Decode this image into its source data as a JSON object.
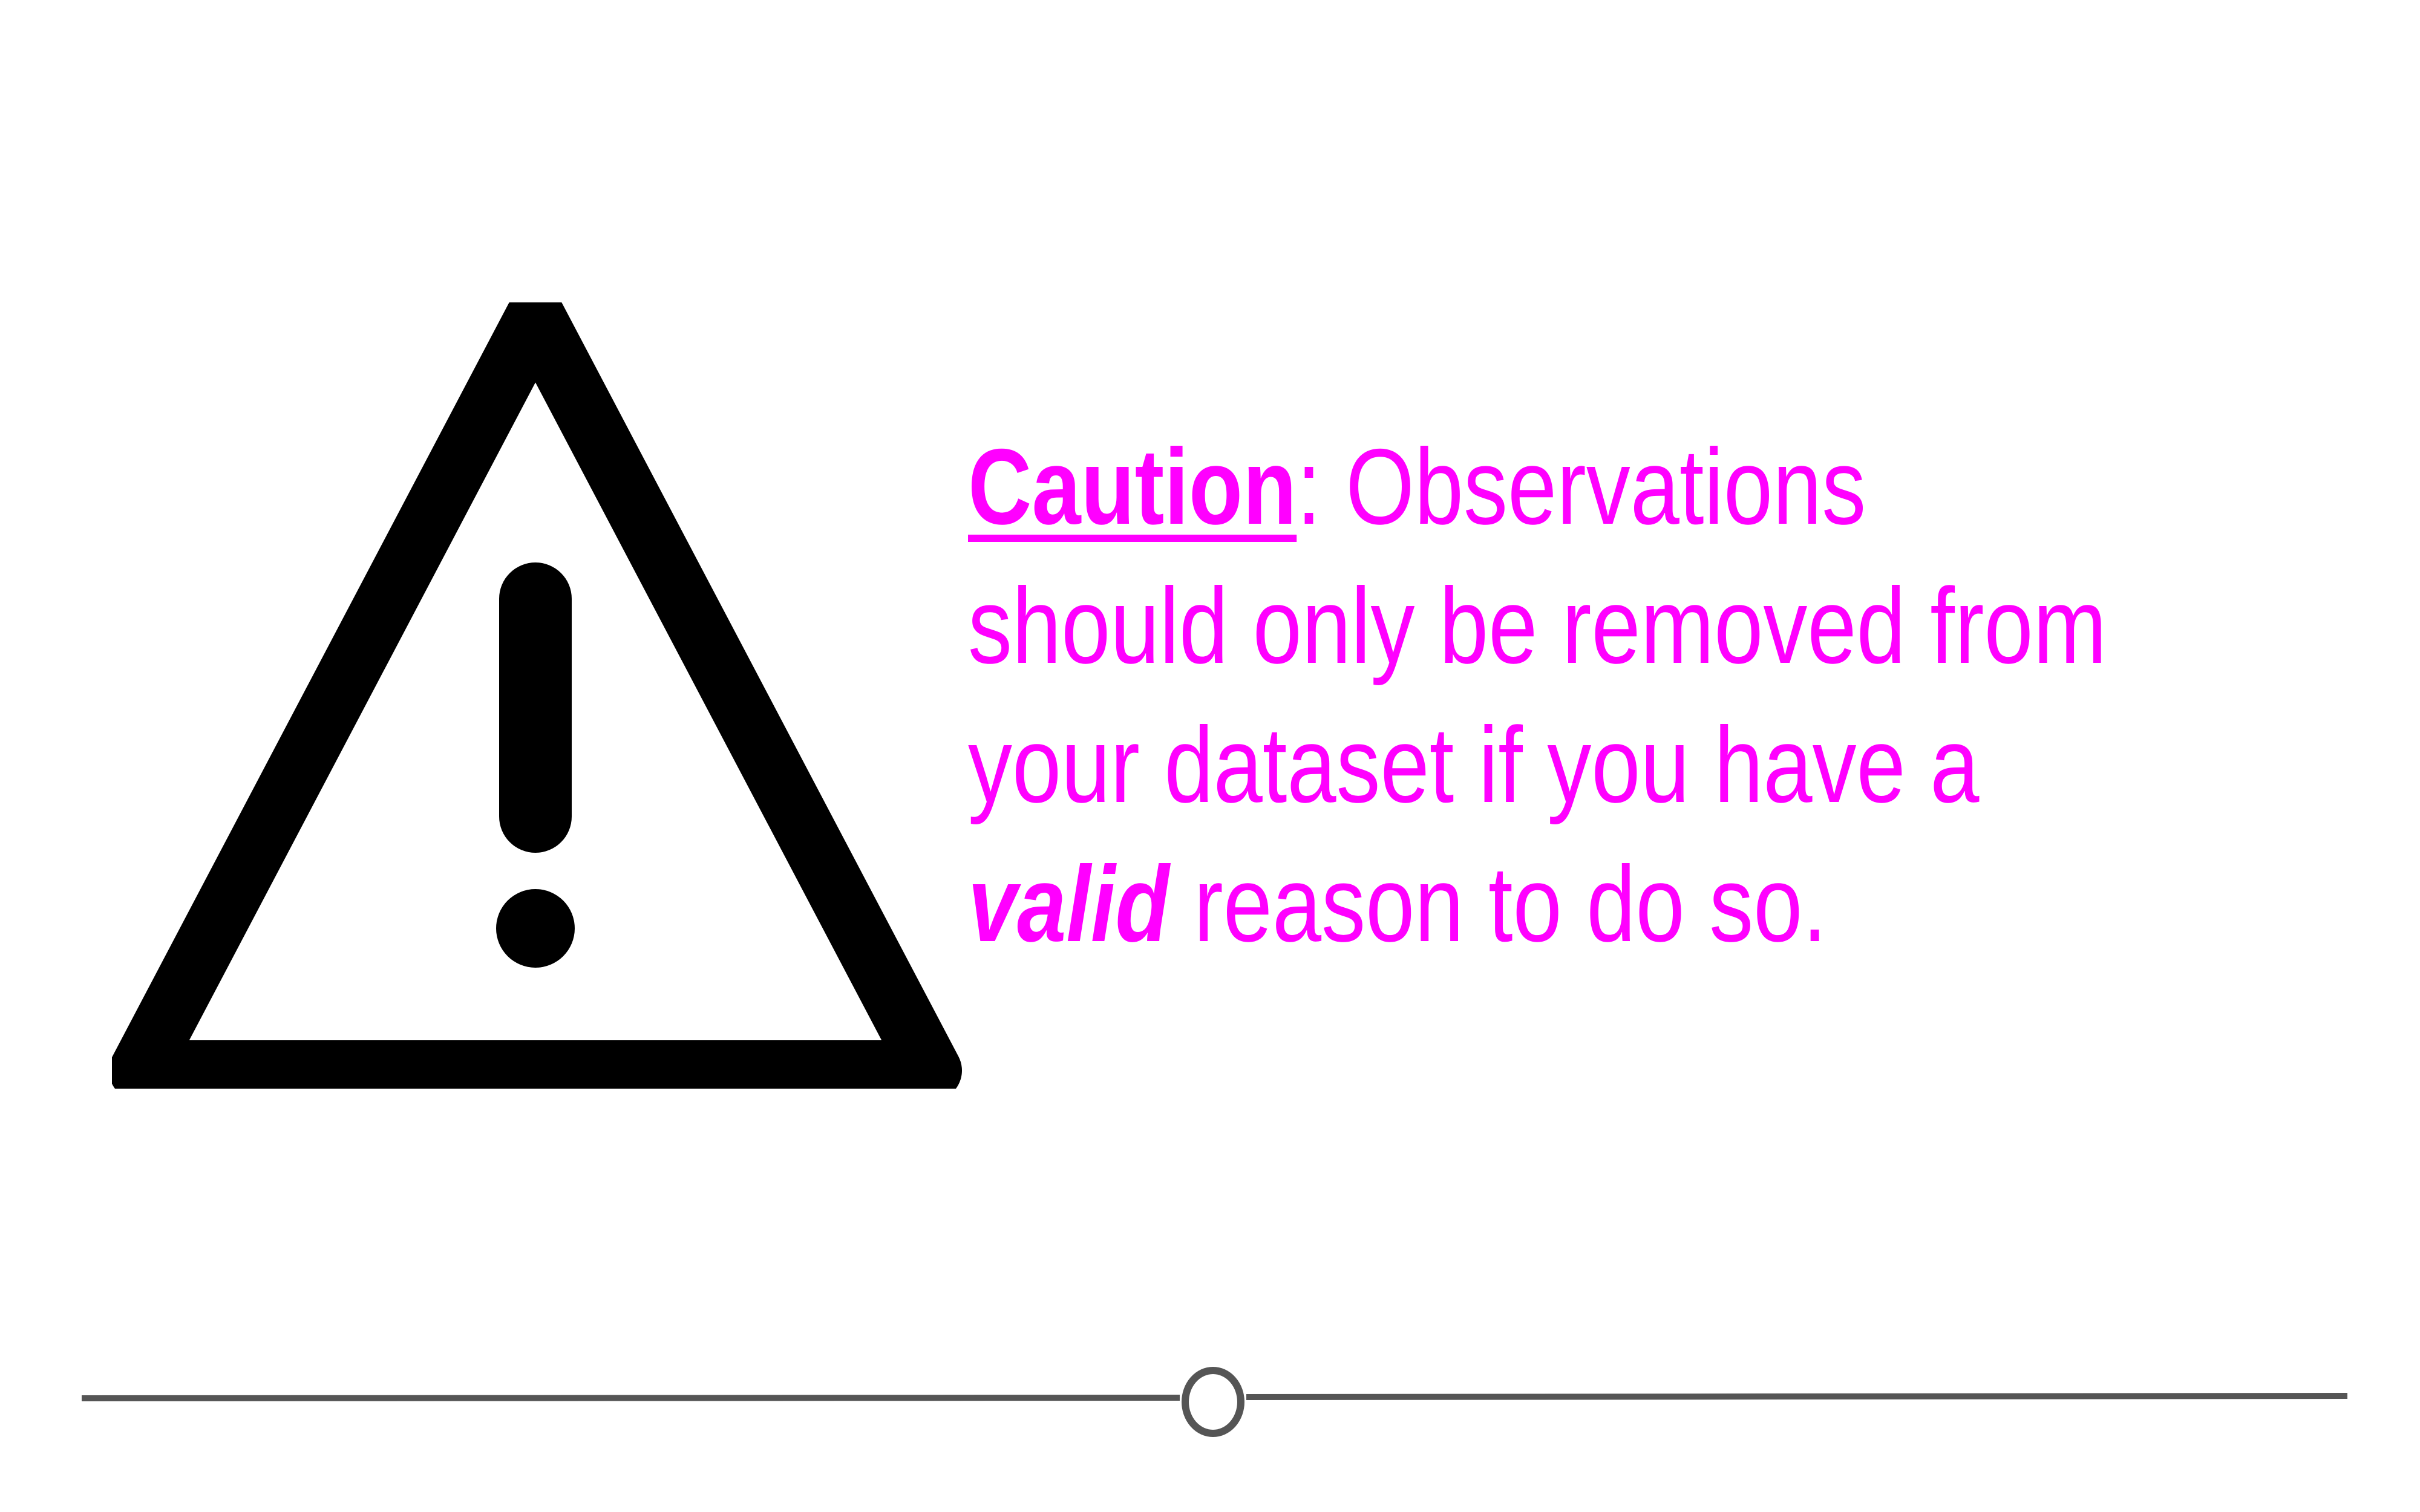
{
  "warning": {
    "icon": "warning-triangle-exclamation-icon",
    "color": "#000000"
  },
  "message": {
    "color": "#ff00ff",
    "caution_label": "Caution",
    "separator": ":",
    "line1_rest": " Observations",
    "line2": "should only be removed from",
    "line3": "your dataset if you have a",
    "valid_word": "valid",
    "line4_rest": " reason to do so."
  },
  "divider": {
    "color": "#555555",
    "knob_icon": "circle-slider-knob"
  }
}
